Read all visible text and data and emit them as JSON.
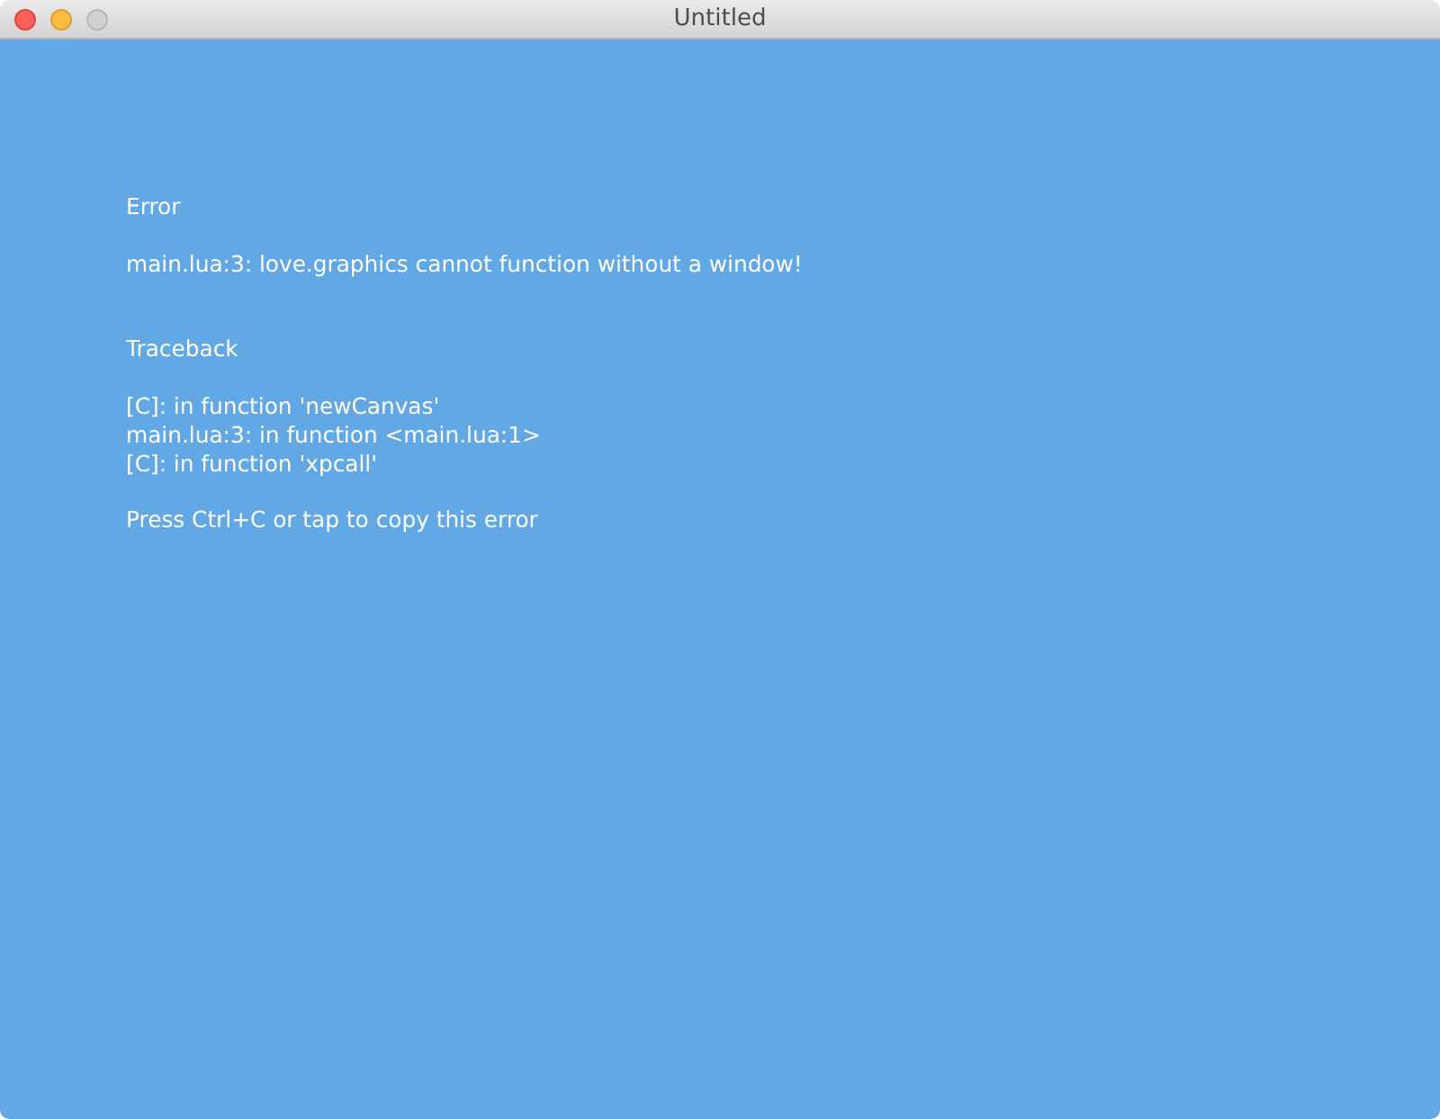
{
  "window": {
    "title": "Untitled",
    "buttons": [
      {
        "kind": "close",
        "disabled": false
      },
      {
        "kind": "minimize",
        "disabled": false
      },
      {
        "kind": "zoom",
        "disabled": true
      }
    ]
  },
  "error": {
    "heading": "Error",
    "message": "main.lua:3: love.graphics cannot function without a window!"
  },
  "traceback": {
    "heading": "Traceback",
    "lines": [
      "[C]: in function 'newCanvas'",
      "main.lua:3: in function <main.lua:1>",
      "[C]: in function 'xpcall'"
    ]
  },
  "hint": "Press Ctrl+C or tap to copy this error"
}
